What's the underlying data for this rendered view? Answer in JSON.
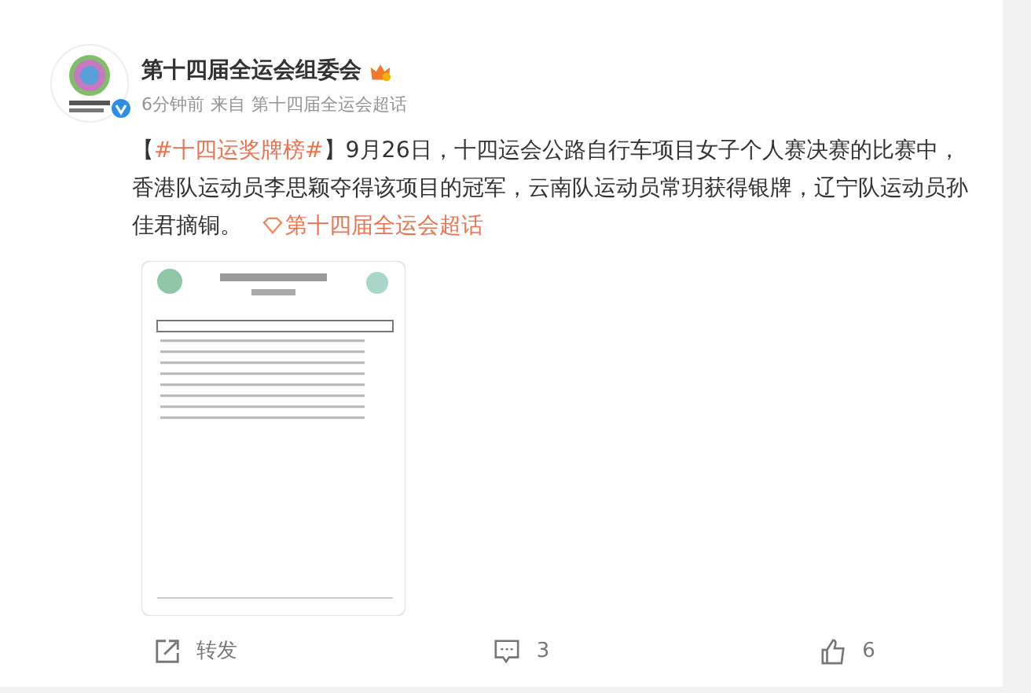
{
  "post": {
    "author": "第十四届全运会组委会",
    "verified": true,
    "meta": {
      "time": "6分钟前",
      "source_prefix": "来自",
      "source": "第十四届全运会超话"
    },
    "body": {
      "open_bracket": "【",
      "close_bracket": "】",
      "topic": "#十四运奖牌榜#",
      "text": "9月26日，十四运会公路自行车项目女子个人赛决赛的比赛中，香港队运动员李思颖夺得该项目的冠军，云南队运动员常玥获得银牌，辽宁队运动员孙佳君摘铜。",
      "super_topic": "第十四届全运会超话"
    },
    "actions": [
      {
        "kind": "repost",
        "label": "转发"
      },
      {
        "kind": "comment",
        "label": "3"
      },
      {
        "kind": "like",
        "label": "6"
      }
    ]
  }
}
